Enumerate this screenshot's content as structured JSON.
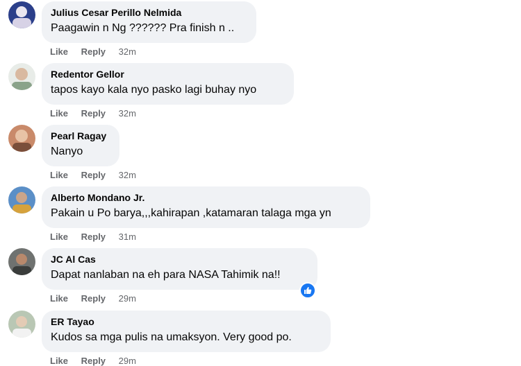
{
  "actions": {
    "like_label": "Like",
    "reply_label": "Reply"
  },
  "comments": [
    {
      "author": "Julius Cesar Perillo Nelmida",
      "text": "Paagawin n Ng ?????? Pra finish n ..",
      "time": "32m"
    },
    {
      "author": "Redentor Gellor",
      "text": "tapos kayo kala nyo pasko lagi buhay nyo",
      "time": "32m"
    },
    {
      "author": "Pearl Ragay",
      "text": "Nanyo",
      "time": "32m"
    },
    {
      "author": "Alberto Mondano Jr.",
      "text": "Pakain u Po barya,,,kahirapan ,katamaran talaga mga yn",
      "time": "31m"
    },
    {
      "author": "JC Al Cas",
      "text": "Dapat nanlaban na eh para NASA Tahimik na!!",
      "time": "29m",
      "reaction": "like-icon"
    },
    {
      "author": "ER Tayao",
      "text": "Kudos sa mga pulis na umaksyon. Very good po.",
      "time": "29m"
    }
  ],
  "colors": {
    "bubble": "#f0f2f5",
    "meta_text": "#65676b",
    "like_blue": "#1877f2"
  }
}
